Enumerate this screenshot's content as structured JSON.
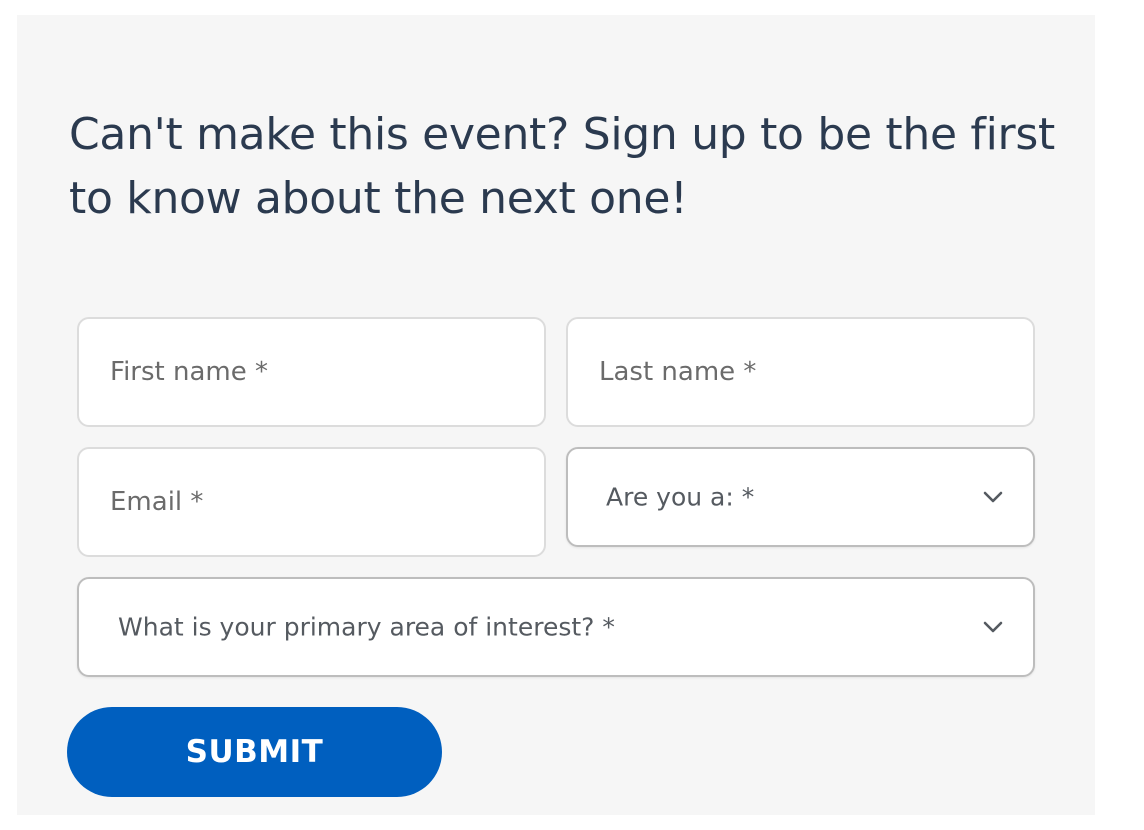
{
  "heading": "Can't make this event? Sign up to be the first to know about the next one!",
  "form": {
    "first_name": {
      "value": "",
      "placeholder": "First name *"
    },
    "last_name": {
      "value": "",
      "placeholder": "Last name *"
    },
    "email": {
      "value": "",
      "placeholder": "Email *"
    },
    "role_select": {
      "selected": "Are you a: *"
    },
    "interest_select": {
      "selected": "What is your primary area of interest? *"
    },
    "submit_label": "SUBMIT"
  },
  "icons": {
    "select_chevron": "chevron-down-icon"
  },
  "colors": {
    "panel_background": "#f6f6f6",
    "heading_text": "#2b3a4f",
    "submit_background": "#005fbf",
    "submit_text": "#ffffff"
  }
}
